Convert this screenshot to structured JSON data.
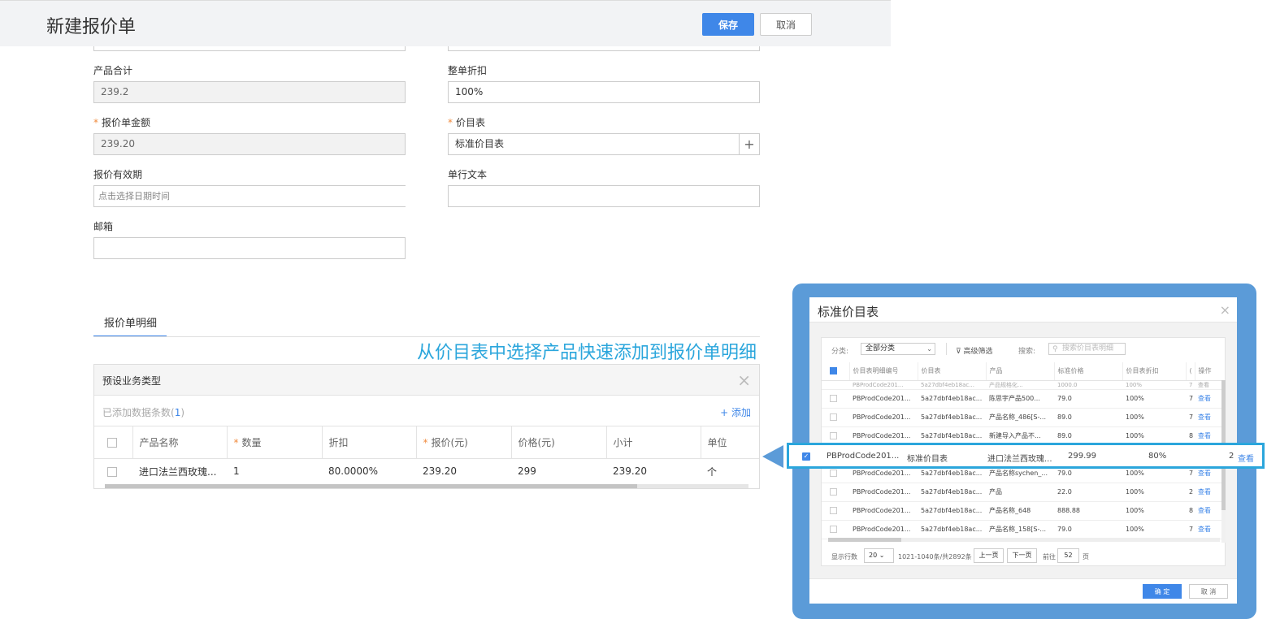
{
  "header": {
    "title": "新建报价单",
    "save_label": "保存",
    "cancel_label": "取消"
  },
  "form": {
    "product_total_label": "产品合计",
    "product_total_value": "239.2",
    "discount_label": "整单折扣",
    "discount_value": "100%",
    "amount_label": "报价单金额",
    "amount_value": "239.20",
    "pricebook_label": "价目表",
    "pricebook_value": "标准价目表",
    "plus_symbol": "+",
    "validity_label": "报价有效期",
    "validity_placeholder": "点击选择日期时间",
    "single_text_label": "单行文本",
    "email_label": "邮箱",
    "required_mark": "*"
  },
  "tabs": [
    {
      "label": "报价单明细"
    }
  ],
  "callout": "从价目表中选择产品快速添加到报价单明细",
  "detail": {
    "type_title": "预设业务类型",
    "count_prefix": "已添加数据条数(",
    "count_num": "1",
    "count_suffix": ")",
    "add_label": "+ 添加",
    "columns": [
      "产品名称",
      "数量",
      "折扣",
      "报价(元)",
      "价格(元)",
      "小计",
      "单位"
    ],
    "row": [
      "进口法兰西玫瑰...",
      "1",
      "80.0000%",
      "239.20",
      "299",
      "239.20",
      "个"
    ]
  },
  "dialog": {
    "title": "标准价目表",
    "category_label": "分类:",
    "category_value": "全部分类",
    "advanced_filter": "高级筛选",
    "search_label": "搜索:",
    "search_placeholder": "搜索价目表明细",
    "columns": [
      "价目表明细编号",
      "价目表",
      "产品",
      "标准价格",
      "价目表折扣",
      "(",
      "操作"
    ],
    "faded_row": [
      "PBProdCode201...",
      "5a27dbf4eb18ac...",
      "产品规格化...",
      "1000.0",
      "100%",
      "7",
      "查看"
    ],
    "rows": [
      [
        "PBProdCode201...",
        "5a27dbf4eb18ac...",
        "陈思宇产品500...",
        "79.0",
        "100%",
        "7",
        "查看"
      ],
      [
        "PBProdCode201...",
        "5a27dbf4eb18ac...",
        "产品名称_486[S-...",
        "89.0",
        "100%",
        "7",
        "查看"
      ],
      [
        "PBProdCode201...",
        "5a27dbf4eb18ac...",
        "新建导入产品不...",
        "89.0",
        "100%",
        "8",
        "查看"
      ],
      [
        "",
        "",
        "",
        "",
        "",
        "",
        ""
      ],
      [
        "PBProdCode201...",
        "5a27dbf4eb18ac...",
        "产品名称sychen_...",
        "79.0",
        "100%",
        "7",
        "查看"
      ],
      [
        "PBProdCode201...",
        "5a27dbf4eb18ac...",
        "产品",
        "22.0",
        "100%",
        "2",
        "查看"
      ],
      [
        "PBProdCode201...",
        "5a27dbf4eb18ac...",
        "产品名称_648",
        "888.88",
        "100%",
        "8",
        "查看"
      ],
      [
        "PBProdCode201...",
        "5a27dbf4eb18ac...",
        "产品名称_158[S-...",
        "79.0",
        "100%",
        "7",
        "查看"
      ]
    ],
    "highlighted_row": [
      "PBProdCode201...",
      "标准价目表",
      "进口法兰西玫瑰...",
      "299.99",
      "80%",
      "2",
      "查看"
    ],
    "check_mark": "✓",
    "pager": {
      "rows_label": "显示行数",
      "rows_value": "20",
      "range": "1021-1040条/共2892条",
      "prev": "上一页",
      "next": "下一页",
      "goto_label": "前往",
      "goto_value": "52",
      "page_unit": "页"
    },
    "ok_label": "确 定",
    "cancel_label": "取 消"
  },
  "icons": {
    "close": "×",
    "dropdown": "⌄",
    "search": "⚲",
    "filter": "⊽"
  },
  "colors": {
    "accent": "#3f87e8",
    "callout": "#2ba6dc",
    "frame": "#5b9bd8",
    "required": "#f08a3c"
  }
}
